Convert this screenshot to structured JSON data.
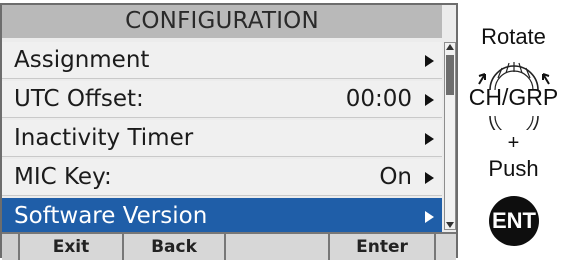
{
  "screen": {
    "title": "CONFIGURATION",
    "menu_items": [
      {
        "label": "Assignment",
        "value": ""
      },
      {
        "label": "UTC Offset:",
        "value": "00:00"
      },
      {
        "label": "Inactivity Timer",
        "value": ""
      },
      {
        "label": "MIC Key:",
        "value": "On"
      },
      {
        "label": "Software Version",
        "value": "",
        "selected": true
      }
    ],
    "softkeys": [
      "Exit",
      "Back",
      "",
      "Enter"
    ],
    "colors": {
      "selected_row": "#1f5ea8",
      "title_bar": "#b9b9b9"
    }
  },
  "side": {
    "rotate_label": "Rotate",
    "dial_label": "CH/GRP",
    "plus_label": "+",
    "push_label": "Push",
    "ent_label": "ENT"
  }
}
